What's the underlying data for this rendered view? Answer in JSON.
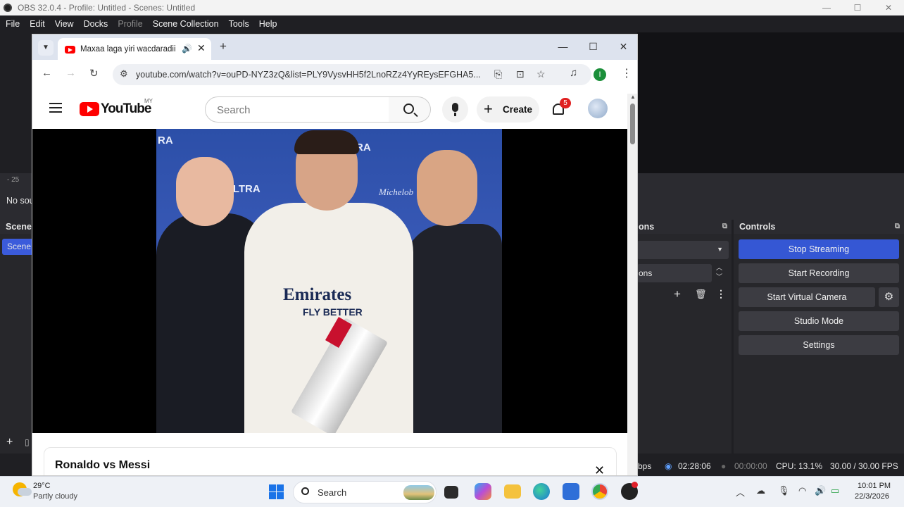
{
  "obs": {
    "window_title": "OBS 32.0.4 - Profile: Untitled - Scenes: Untitled",
    "menu": [
      "File",
      "Edit",
      "View",
      "Docks",
      "Profile",
      "Scene Collection",
      "Tools",
      "Help"
    ],
    "preview_left_label": "-  25",
    "no_source_label": "No sou",
    "scenes_header": "Scene",
    "scene_item": "Scene",
    "transitions_header": "ons",
    "transition_label": "ons",
    "controls_header": "Controls",
    "controls": {
      "stop_streaming": "Stop Streaming",
      "start_recording": "Start Recording",
      "start_virtual_camera": "Start Virtual Camera",
      "studio_mode": "Studio Mode",
      "settings": "Settings"
    },
    "status": {
      "bitrate_unit": "bps",
      "stream_time": "02:28:06",
      "record_time": "00:00:00",
      "cpu": "CPU: 13.1%",
      "fps": "30.00 / 30.00 FPS"
    },
    "window_controls": {
      "minimize": "—",
      "maximize": "☐",
      "close": "✕"
    }
  },
  "browser": {
    "tab_title": "Maxaa laga yiri wacdaradii",
    "url": "youtube.com/watch?v=ouPD-NYZ3zQ&list=PLY9VysvHH5f2LnoRZz4YyREysEFGHA5...",
    "profile_initial": "I",
    "window_controls": {
      "minimize": "—",
      "maximize": "☐",
      "close": "✕"
    }
  },
  "youtube": {
    "logo_text": "YouTube",
    "region": "MY",
    "search_placeholder": "Search",
    "create_label": "Create",
    "notification_count": "5",
    "video_title": "Ronaldo vs Messi",
    "video_image": {
      "shirt_text_1": "Emirates",
      "shirt_text_2": "FLY BETTER",
      "banner_text": "RA",
      "banner_text_2": "ULTRA",
      "banner_script": "Michelob"
    }
  },
  "taskbar": {
    "temperature": "29°C",
    "weather": "Partly cloudy",
    "search_label": "Search",
    "time": "10:01 PM",
    "date": "22/3/2026"
  }
}
